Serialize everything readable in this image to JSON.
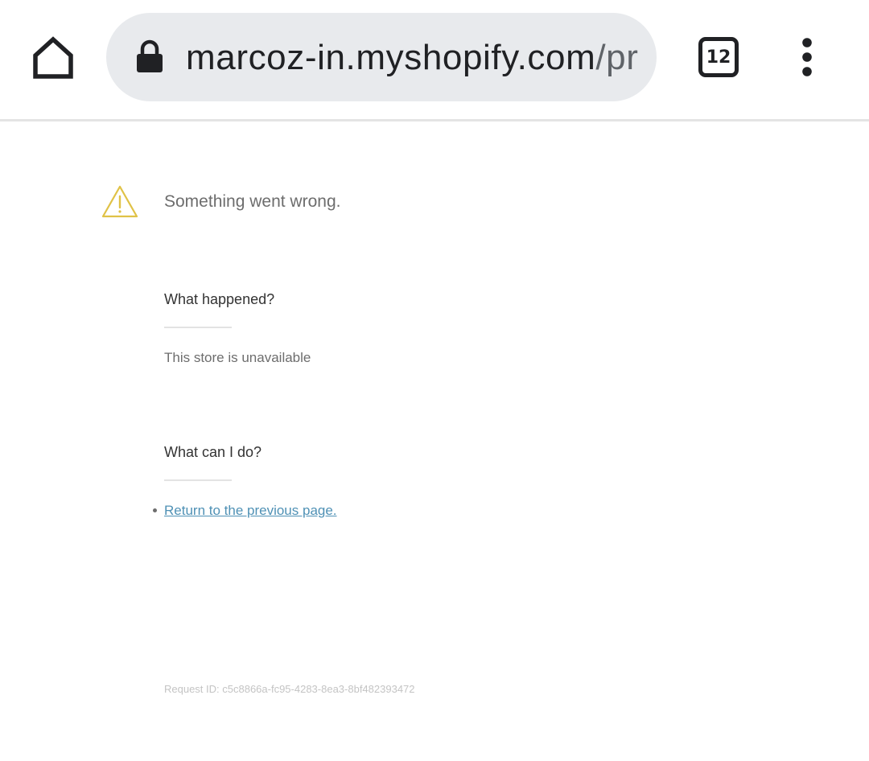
{
  "browser": {
    "url_host": "marcoz-in.myshopify.com",
    "url_path": "/pr",
    "tab_count": "12",
    "icons": {
      "home": "home-icon",
      "lock": "lock-icon",
      "tabs": "tab-switcher-icon",
      "menu": "more-vert-icon"
    }
  },
  "error_page": {
    "heading": "Something went wrong.",
    "what_happened_title": "What happened?",
    "what_happened_text": "This store is unavailable",
    "what_can_i_do_title": "What can I do?",
    "return_link": "Return to the previous page.",
    "request_id": "Request ID: c5c8866a-fc95-4283-8ea3-8bf482393472",
    "icon": "warning-icon"
  },
  "colors": {
    "omnibox_bg": "#e8eaed",
    "warning": "#e0c247",
    "link": "#4f91b5",
    "muted_text": "#6d6d6d"
  }
}
